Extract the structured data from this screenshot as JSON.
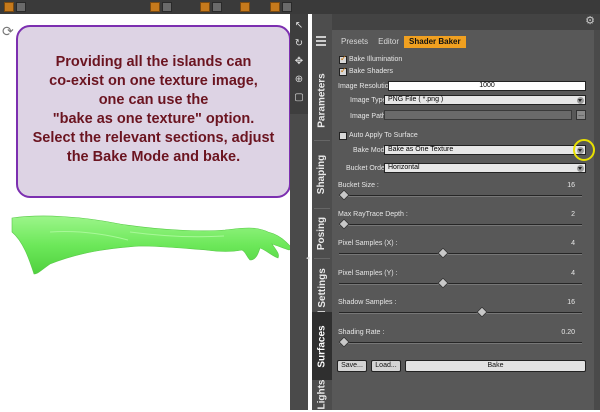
{
  "callout": {
    "text": "Providing all the islands can\nco-exist on one texture image,\none can use the\n\"bake as one texture\" option.\nSelect the relevant sections, adjust\nthe Bake Mode and bake."
  },
  "side_tabs": [
    "Parameters",
    "Shaping",
    "Posing",
    "Tool Settings",
    "Surfaces",
    "Lights"
  ],
  "active_side_tab": "Surfaces",
  "panel": {
    "tabs": [
      "Presets",
      "Editor",
      "Shader Baker"
    ],
    "active_tab": "Shader Baker",
    "bake_illumination": {
      "label": "Bake Illumination",
      "checked": true
    },
    "bake_shaders": {
      "label": "Bake Shaders",
      "checked": true
    },
    "image_resolution": {
      "label": "Image Resolution :",
      "value": "1000"
    },
    "image_type": {
      "label": "Image Type :",
      "value": "PNG File ( *.png )"
    },
    "image_path": {
      "label": "Image Path :",
      "value": "",
      "button": "..."
    },
    "auto_apply": {
      "label": "Auto Apply To Surface",
      "checked": false
    },
    "bake_mode": {
      "label": "Bake Mode :",
      "value": "Bake as One Texture"
    },
    "bucket_order": {
      "label": "Bucket Order :",
      "value": "Horizontal"
    },
    "sliders": [
      {
        "label": "Bucket Size :",
        "value": "16",
        "fraction": 0.02
      },
      {
        "label": "Max RayTrace Depth :",
        "value": "2",
        "fraction": 0.02
      },
      {
        "label": "Pixel Samples (X) :",
        "value": "4",
        "fraction": 0.43
      },
      {
        "label": "Pixel Samples (Y) :",
        "value": "4",
        "fraction": 0.43
      },
      {
        "label": "Shadow Samples :",
        "value": "16",
        "fraction": 0.59
      },
      {
        "label": "Shading Rate :",
        "value": "0.20",
        "fraction": 0.02
      }
    ],
    "save_button": "Save...",
    "load_button": "Load...",
    "bake_button": "Bake"
  },
  "colors": {
    "callout_bg": "#ddd3e4",
    "callout_border": "#7c2fb0",
    "callout_text": "#6b1420",
    "active_tab": "#f0a020",
    "mesh": "#7cf06a",
    "highlight": "#e8e000"
  },
  "icons": {
    "viewport_toolbar": [
      "select-icon",
      "rotate-icon",
      "pan-icon",
      "zoom-icon",
      "frame-icon"
    ],
    "panel_options": "gear-icon"
  }
}
